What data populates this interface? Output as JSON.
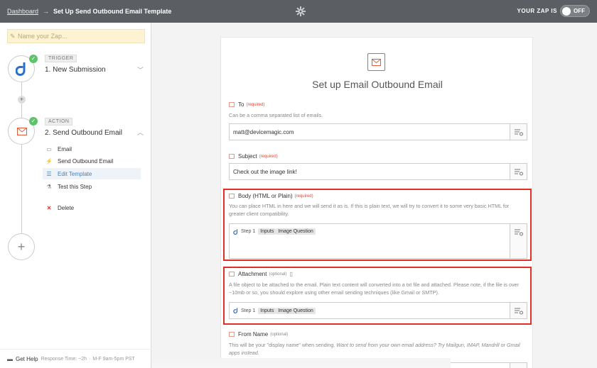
{
  "header": {
    "breadcrumb_link": "Dashboard",
    "breadcrumb_sep": "→",
    "breadcrumb_title": "Set Up Send Outbound Email Template",
    "zap_status_label": "YOUR ZAP IS",
    "toggle_label": "OFF",
    "center_icon": "gear-icon"
  },
  "sidebar": {
    "zap_name_placeholder": "Name your Zap...",
    "trigger": {
      "badge": "TRIGGER",
      "title": "1. New Submission"
    },
    "action": {
      "badge": "ACTION",
      "title": "2. Send Outbound Email"
    },
    "sub_items": [
      {
        "label": "Email",
        "icon": "email-icon"
      },
      {
        "label": "Send Outbound Email",
        "icon": "bolt-icon"
      },
      {
        "label": "Edit Template",
        "icon": "list-icon",
        "active": true
      },
      {
        "label": "Test this Step",
        "icon": "flask-icon"
      }
    ],
    "delete_label": "Delete",
    "help": {
      "label": "Get Help",
      "response": "Response Time: ~2h",
      "hours": "M-F 9am-5pm PST"
    }
  },
  "main": {
    "title": "Set up Email Outbound Email",
    "fields": {
      "to": {
        "label": "To",
        "required": "(required)",
        "help": "Can be a comma separated list of emails.",
        "value": "matt@devicemagic.com"
      },
      "subject": {
        "label": "Subject",
        "required": "(required)",
        "value": "Check out the image link!"
      },
      "body": {
        "label": "Body (HTML or Plain)",
        "required": "(required)",
        "help": "You can place HTML in here and we will send it as is. If this is plain text, we will try to convert it to some very basic HTML for greater client compatibility.",
        "step": "Step 1",
        "pill1": "Inputs",
        "pill2": "Image Question"
      },
      "attachment": {
        "label": "Attachment",
        "optional": "(optional)",
        "help": "A file object to be attached to the email. Plain text content will converted into a txt file and attached. Please note, if the file is over ~10mb or so, you should explore using other email sending techniques (like Gmail or SMTP).",
        "step": "Step 1",
        "pill1": "Inputs",
        "pill2": "Image Question"
      },
      "from_name": {
        "label": "From Name",
        "optional": "(optional)",
        "help_plain": "This will be your \"display name\" when sending.",
        "help_italic": "Want to send from your own email address? Try Mailgun, IMAP, Mandrill or Gmail apps instead."
      }
    }
  },
  "colors": {
    "topbar": "#5b5f63",
    "accent_blue": "#3a84c9",
    "highlight_red": "#e02f24",
    "success_green": "#5ec26a",
    "email_orange": "#e55d3b"
  }
}
